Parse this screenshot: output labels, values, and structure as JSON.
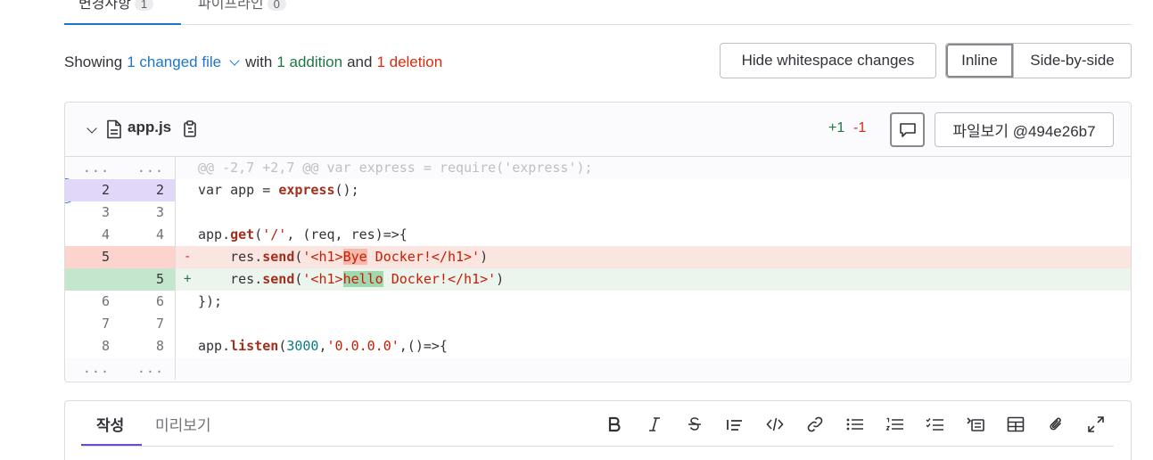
{
  "top_tabs": [
    {
      "label": "변경사항",
      "count": "1"
    },
    {
      "label": "파이프라인",
      "count": "0"
    }
  ],
  "summary": {
    "prefix": "Showing",
    "changed_files": "1 changed file",
    "with": "with",
    "additions": "1 addition",
    "and": "and",
    "deletions": "1 deletion"
  },
  "buttons": {
    "hide_whitespace": "Hide whitespace changes",
    "inline": "Inline",
    "side_by_side": "Side-by-side"
  },
  "file": {
    "name": "app.js",
    "added": "+1",
    "removed": "-1",
    "view_file": "파일보기 @494e26b7"
  },
  "diff": {
    "hunk_header": "@@ -2,7 +2,7 @@ var express = require('express');",
    "ellipsis": "...",
    "lines": [
      {
        "old": "2",
        "new": "2",
        "code": "var app = express();"
      },
      {
        "old": "3",
        "new": "3",
        "code": ""
      },
      {
        "old": "4",
        "new": "4",
        "code": "app.get('/', (req, res)=>{"
      },
      {
        "old": "5",
        "new": "",
        "sign": "-",
        "code": "    res.send('<h1>Bye Docker!</h1>')"
      },
      {
        "old": "",
        "new": "5",
        "sign": "+",
        "code": "    res.send('<h1>hello Docker!</h1>')"
      },
      {
        "old": "6",
        "new": "6",
        "code": "});"
      },
      {
        "old": "7",
        "new": "7",
        "code": ""
      },
      {
        "old": "8",
        "new": "8",
        "code": "app.listen(3000,'0.0.0.0',()=>{"
      }
    ]
  },
  "editor": {
    "tab_write": "작성",
    "tab_preview": "미리보기"
  },
  "toolbar_icons": [
    "bold-icon",
    "italic-icon",
    "strikethrough-icon",
    "quote-icon",
    "code-icon",
    "link-icon",
    "bulleted-list-icon",
    "numbered-list-icon",
    "task-list-icon",
    "collapsible-icon",
    "table-icon",
    "attach-icon",
    "fullscreen-icon"
  ]
}
